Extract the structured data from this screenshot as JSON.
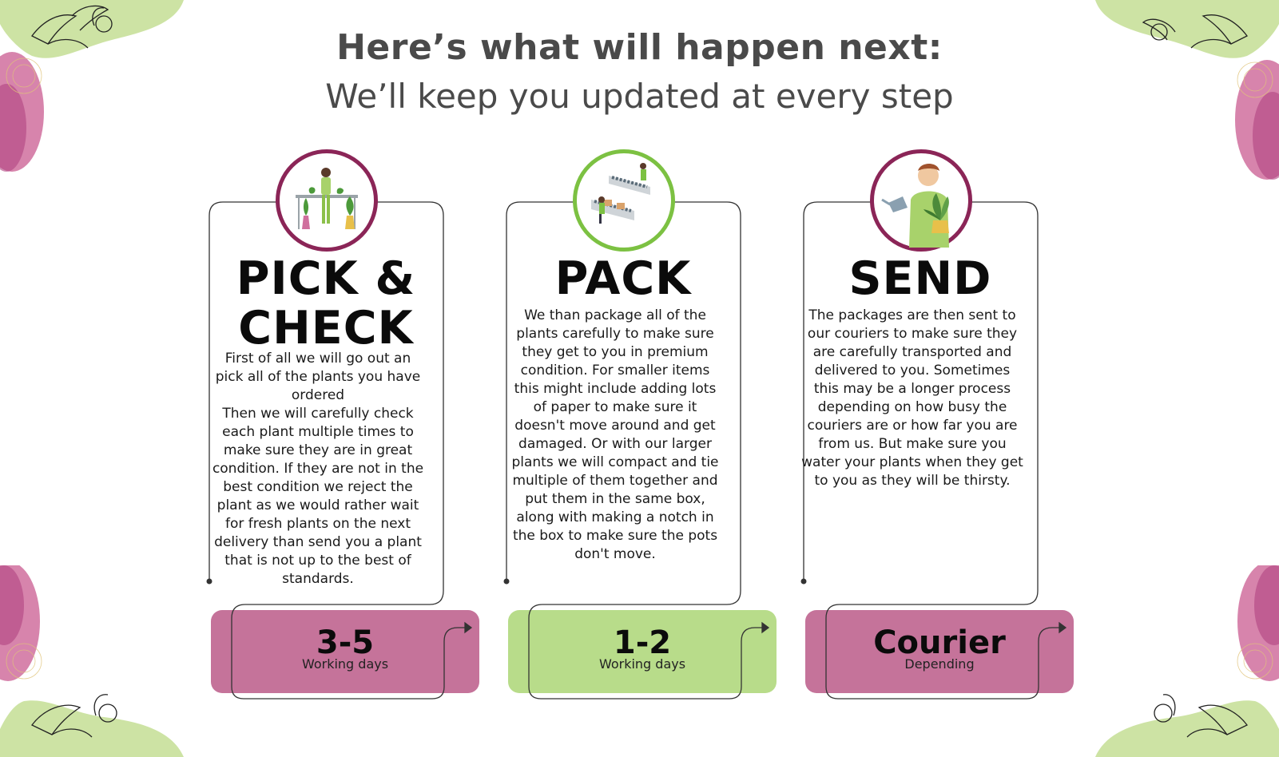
{
  "header": {
    "title": "Here’s what will happen next:",
    "subtitle": "We’ll keep you updated at every step"
  },
  "colors": {
    "accent_pink": "#c5739a",
    "accent_green": "#b8dc8a",
    "ring_purple": "#8b2557",
    "ring_green": "#7cc142",
    "header_text": "#4a4a4a"
  },
  "steps": [
    {
      "icon": "florist-woman-illustration",
      "title_line1": "PICK &",
      "title_line2": "CHECK",
      "text": "First of all we will go out an\npick all of the plants you have\nordered\nThen we will carefully check\neach plant multiple times to\nmake sure they are in great\ncondition. If they are not in the\nbest condition we reject the\nplant as we would rather wait\nfor fresh plants on the next\ndelivery than send you a plant\nthat is not up to the best of\nstandards.",
      "duration": "3-5",
      "duration_label": "Working days"
    },
    {
      "icon": "packing-workers-illustration",
      "title_line1": "PACK",
      "title_line2": "",
      "text": "We than package all of the\nplants carefully to make sure\nthey get to you in premium\ncondition. For smaller items\nthis might include adding lots\nof paper to make sure it\ndoesn't move around and get\ndamaged. Or with our larger\nplants we will compact and tie\nmultiple of them together and\nput them in the same box,\nalong with making a notch in\nthe box to make sure the pots\ndon't move.",
      "duration": "1-2",
      "duration_label": "Working days"
    },
    {
      "icon": "man-watering-plant-illustration",
      "title_line1": "SEND",
      "title_line2": "",
      "text": "The packages are then sent to\nour couriers to make sure they\nare carefully transported and\ndelivered to you. Sometimes\nthis may be a longer process\ndepending on how busy the\ncouriers are or how far you are\nfrom us. But make sure you\nwater your plants when they get\nto you as they will be thirsty.",
      "duration": "Courier",
      "duration_label": "Depending"
    }
  ]
}
